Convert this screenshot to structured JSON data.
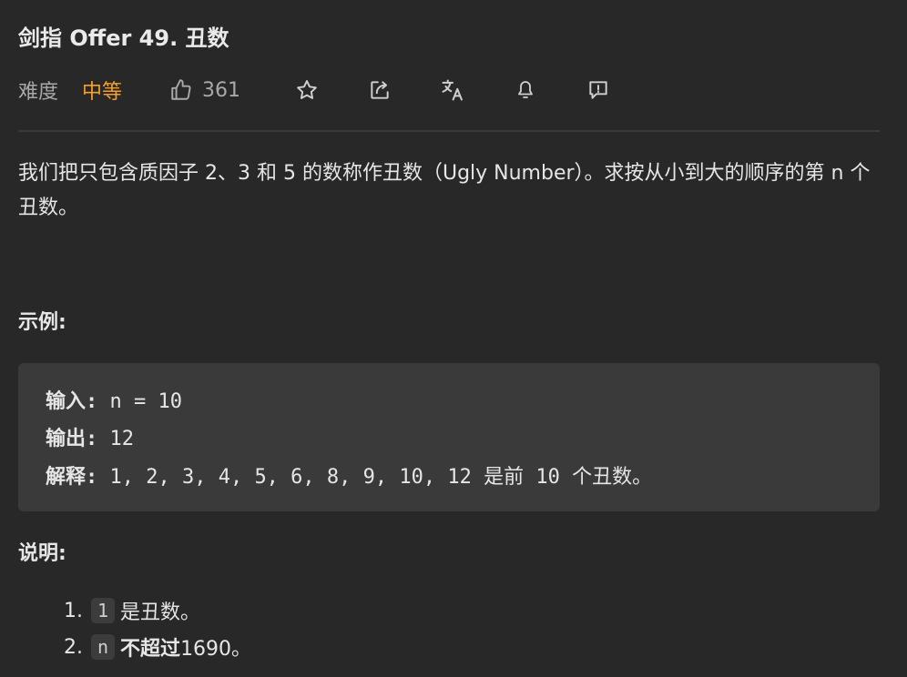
{
  "problem": {
    "title": "剑指 Offer 49. 丑数"
  },
  "toolbar": {
    "difficulty_label": "难度",
    "difficulty_value": "中等",
    "likes": "361",
    "icons": [
      "thumb-up-icon",
      "star-icon",
      "share-icon",
      "translate-icon",
      "bell-icon",
      "feedback-icon"
    ]
  },
  "description": {
    "text": "我们把只包含质因子 2、3 和 5 的数称作丑数（Ugly Number）。求按从小到大的顺序的第 n 个丑数。"
  },
  "example": {
    "heading": "示例:",
    "input_label": "输入:",
    "input_value": "n = 10",
    "output_label": "输出:",
    "output_value": "12",
    "explain_label": "解释:",
    "explain_value": "1, 2, 3, 4, 5, 6, 8, 9, 10, 12 是前 10 个丑数。"
  },
  "notes": {
    "heading": "说明:",
    "items": [
      {
        "num": "1.",
        "code": "1",
        "text": "是丑数。",
        "bold_text": "",
        "tail": ""
      },
      {
        "num": "2.",
        "code": "n",
        "text": "",
        "bold_text": "不超过",
        "tail": "1690。"
      }
    ]
  },
  "colors": {
    "background": "#282828",
    "code_background": "#3a3a3a",
    "difficulty_medium": "#f5a02a",
    "muted_text": "#a9a9a9"
  }
}
